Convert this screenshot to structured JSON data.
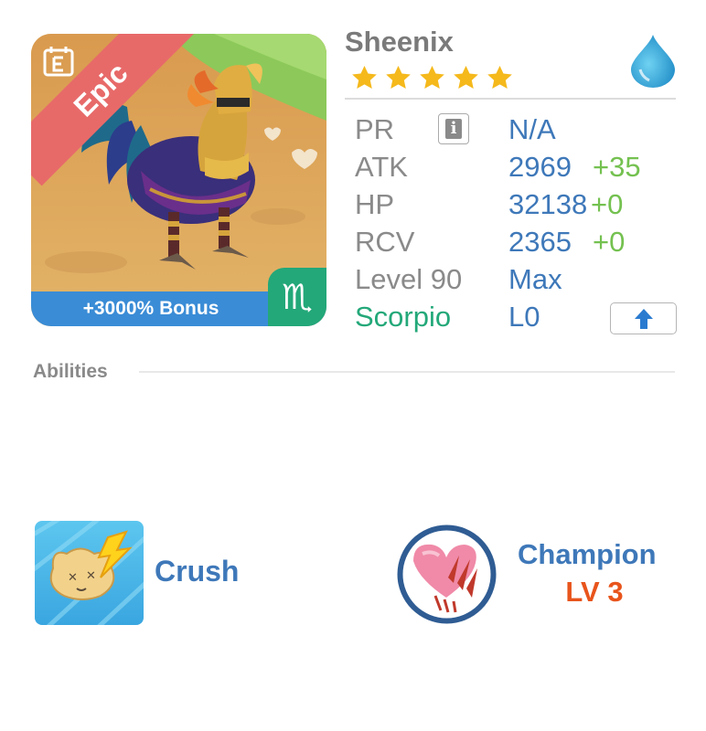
{
  "monster": {
    "name": "Sheenix",
    "rarity": "Epic",
    "stars": 5,
    "bonus": "+3000% Bonus",
    "zodiac_symbol": "♏",
    "element_icon": "water-drop-icon",
    "event_icon": "calendar-event-icon"
  },
  "stats": {
    "pr": {
      "label": "PR",
      "value": "N/A"
    },
    "atk": {
      "label": "ATK",
      "value": "2969",
      "bonus": "+35"
    },
    "hp": {
      "label": "HP",
      "value": "32138",
      "bonus": "+0"
    },
    "rcv": {
      "label": "RCV",
      "value": "2365",
      "bonus": "+0"
    },
    "level": {
      "label": "Level 90",
      "value": "Max"
    },
    "zodiac": {
      "label": "Scorpio",
      "value": "L0"
    }
  },
  "abilities": {
    "title": "Abilities",
    "items": [
      {
        "name": "Crush",
        "icon": "crush-icon"
      },
      {
        "name": "Champion",
        "level": "LV 3",
        "icon": "heart-claw-icon"
      }
    ]
  },
  "colors": {
    "value_blue": "#3e78b9",
    "bonus_green": "#74c150",
    "zodiac_green": "#23a879",
    "star_gold": "#f5b91c",
    "level_orange": "#e8541b",
    "epic_ribbon": "#e76a69"
  }
}
